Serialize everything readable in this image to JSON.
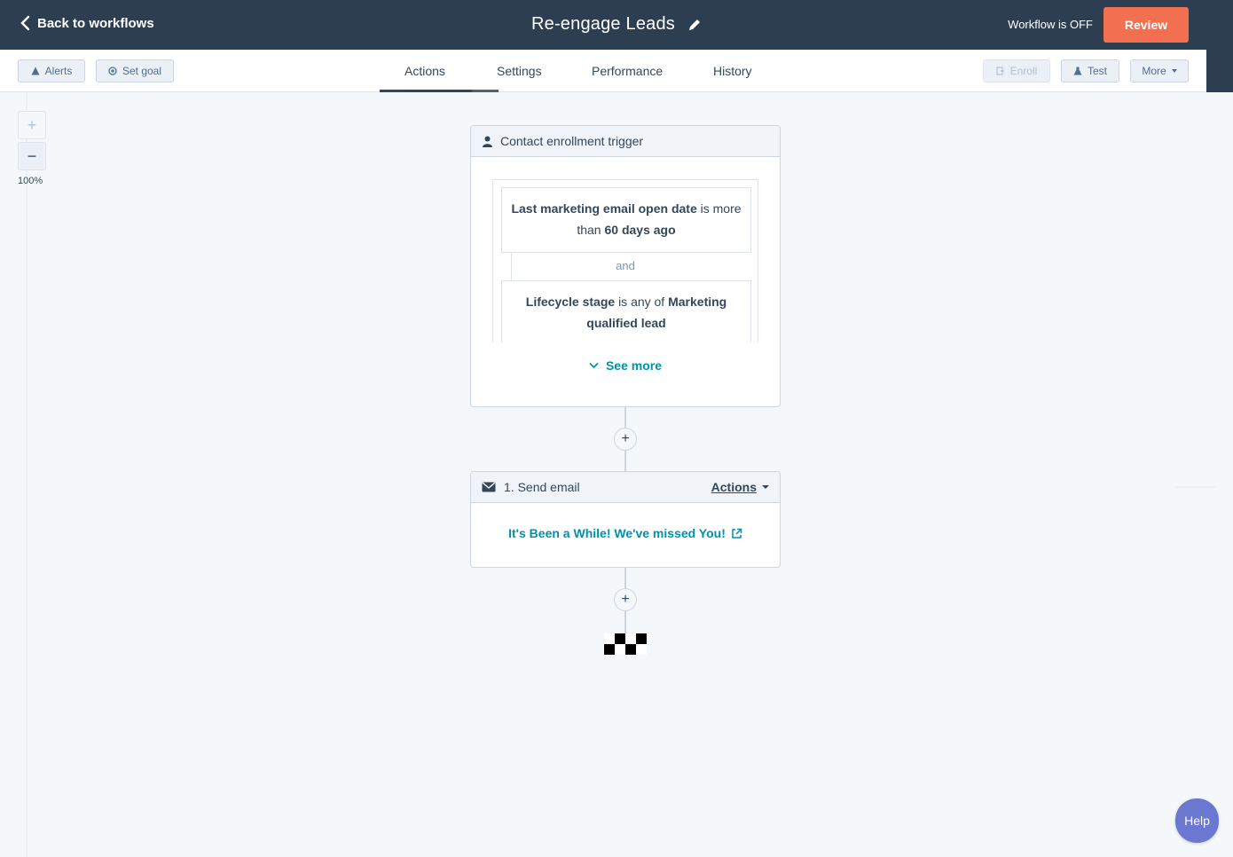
{
  "header": {
    "back_label": "Back to workflows",
    "title": "Re-engage Leads",
    "status": "Workflow is OFF",
    "review_label": "Review"
  },
  "toolbar": {
    "alerts_label": "Alerts",
    "set_goal_label": "Set goal",
    "enroll_label": "Enroll",
    "test_label": "Test",
    "more_label": "More"
  },
  "tabs": [
    {
      "label": "Actions",
      "active": true
    },
    {
      "label": "Settings"
    },
    {
      "label": "Performance"
    },
    {
      "label": "History"
    }
  ],
  "zoom": {
    "in": "+",
    "out": "−",
    "level": "100%"
  },
  "trigger": {
    "title": "Contact enrollment trigger",
    "filter1": {
      "prop": "Last marketing email open date",
      "op": "is more than",
      "value": "60 days ago"
    },
    "and_label": "and",
    "filter2": {
      "prop": "Lifecycle stage",
      "op": "is any of",
      "value": "Marketing qualified lead"
    },
    "see_more_label": "See more"
  },
  "steps": [
    {
      "title": "1. Send email",
      "actions_label": "Actions",
      "email_name": "It's Been a While! We've missed You!"
    }
  ],
  "add_action": "+",
  "help_label": "Help",
  "colors": {
    "header_bg": "#2d3e50",
    "review": "#f2704f",
    "link": "#0091ae",
    "help": "#6a78d1"
  }
}
